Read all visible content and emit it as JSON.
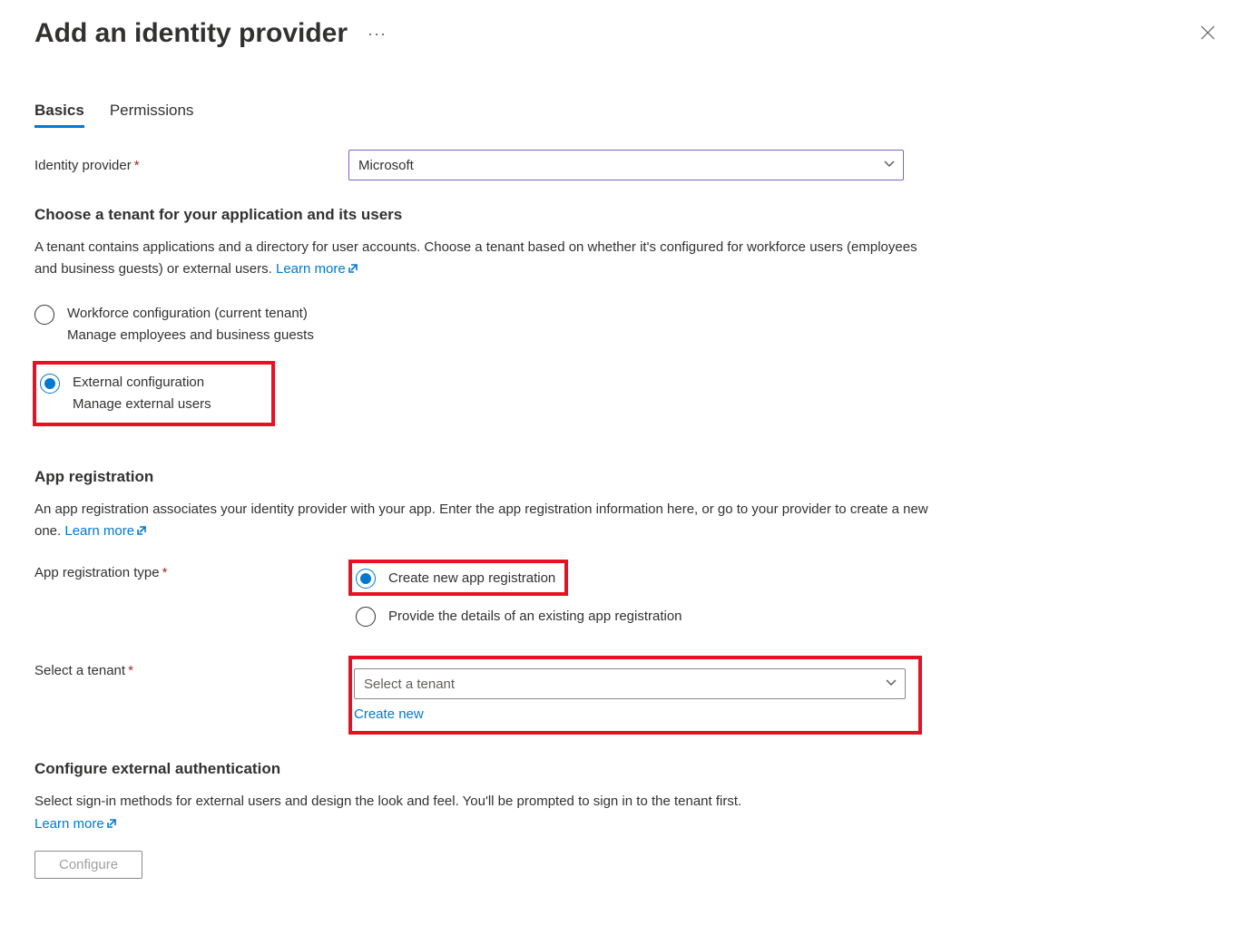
{
  "header": {
    "title": "Add an identity provider"
  },
  "tabs": {
    "basics": "Basics",
    "permissions": "Permissions"
  },
  "identity_provider": {
    "label": "Identity provider",
    "value": "Microsoft"
  },
  "tenant_choice": {
    "heading": "Choose a tenant for your application and its users",
    "desc": "A tenant contains applications and a directory for user accounts. Choose a tenant based on whether it's configured for workforce users (employees and business guests) or external users. ",
    "learn_more": "Learn more",
    "workforce": {
      "label": "Workforce configuration (current tenant)",
      "sub": "Manage employees and business guests"
    },
    "external": {
      "label": "External configuration",
      "sub": "Manage external users"
    }
  },
  "app_reg": {
    "heading": "App registration",
    "desc": "An app registration associates your identity provider with your app. Enter the app registration information here, or go to your provider to create a new one. ",
    "learn_more": "Learn more",
    "type_label": "App registration type",
    "create_new": "Create new app registration",
    "provide_existing": "Provide the details of an existing app registration"
  },
  "select_tenant": {
    "label": "Select a tenant",
    "placeholder": "Select a tenant",
    "create_new": "Create new"
  },
  "ext_auth": {
    "heading": "Configure external authentication",
    "desc": "Select sign-in methods for external users and design the look and feel. You'll be prompted to sign in to the tenant first. ",
    "learn_more": "Learn more",
    "configure": "Configure"
  }
}
